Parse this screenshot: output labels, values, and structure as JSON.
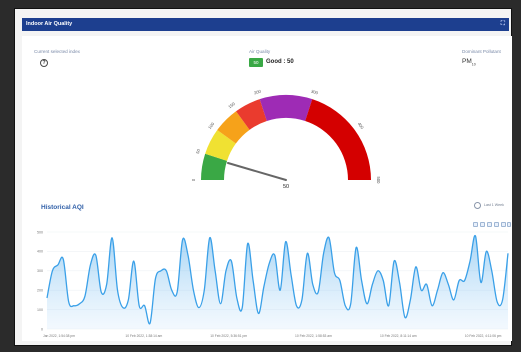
{
  "window": {
    "title": "Indoor Air Quality",
    "expand_icon": "expand-icon",
    "expand_glyph": "⛶"
  },
  "header": {
    "current_index_label": "Current selected index",
    "help_icon_glyph": "?",
    "aq_label": "Air Quality",
    "aq_badge": "50",
    "aq_status": "Good : 50",
    "pollutant_label": "Dominant Pollutant",
    "pollutant_main": "PM",
    "pollutant_sub": "10"
  },
  "gauge": {
    "value": 50,
    "value_label": "50",
    "min": 0,
    "max": 500,
    "ticks": [
      "0",
      "50",
      "100",
      "150",
      "200",
      "300",
      "400",
      "500"
    ],
    "bands": [
      {
        "from": 0,
        "to": 50,
        "color": "#3aa845"
      },
      {
        "from": 50,
        "to": 100,
        "color": "#f0e132"
      },
      {
        "from": 100,
        "to": 150,
        "color": "#f6a21a"
      },
      {
        "from": 150,
        "to": 200,
        "color": "#ea3b2e"
      },
      {
        "from": 200,
        "to": 300,
        "color": "#9e2bb5"
      },
      {
        "from": 300,
        "to": 500,
        "color": "#d40000"
      }
    ]
  },
  "history": {
    "title": "Historical AQI",
    "zoom_label": "Last 1 Week",
    "toolbar_icons": [
      "zoom-in-icon",
      "zoom-out-icon",
      "search-icon",
      "pan-icon",
      "home-icon",
      "menu-icon"
    ]
  },
  "chart_data": {
    "type": "area",
    "title": "Historical AQI",
    "y_ticks": [
      "0",
      "100",
      "200",
      "300",
      "400",
      "500"
    ],
    "ylim": [
      0,
      500
    ],
    "x_ticks": [
      "Jan 2022, 1:54:38 pm",
      "10 Feb 2022, 1:38:14 am",
      "10 Feb 2022, 5:36:51 pm",
      "10 Feb 2022, 1:58:53 am",
      "10 Feb 2022, 8:11:14 am",
      "10 Feb 2022, 4:11:06 pm"
    ],
    "series": [
      {
        "values": [
          160,
          300,
          330,
          360,
          140,
          120,
          130,
          170,
          330,
          380,
          190,
          230,
          470,
          200,
          110,
          150,
          350,
          120,
          120,
          30,
          260,
          300,
          300,
          200,
          190,
          460,
          380,
          200,
          110,
          200,
          470,
          300,
          130,
          300,
          350,
          160,
          110,
          440,
          250,
          80,
          220,
          340,
          380,
          200,
          450,
          280,
          120,
          150,
          390,
          230,
          190,
          390,
          470,
          290,
          250,
          120,
          130,
          420,
          250,
          130,
          230,
          300,
          250,
          120,
          350,
          240,
          60,
          150,
          320,
          200,
          230,
          120,
          200,
          290,
          230,
          150,
          250,
          250,
          350,
          480,
          240,
          400,
          300,
          140,
          150,
          390
        ]
      }
    ],
    "color": "#3aa0e8",
    "fill": "#cde6fb"
  }
}
